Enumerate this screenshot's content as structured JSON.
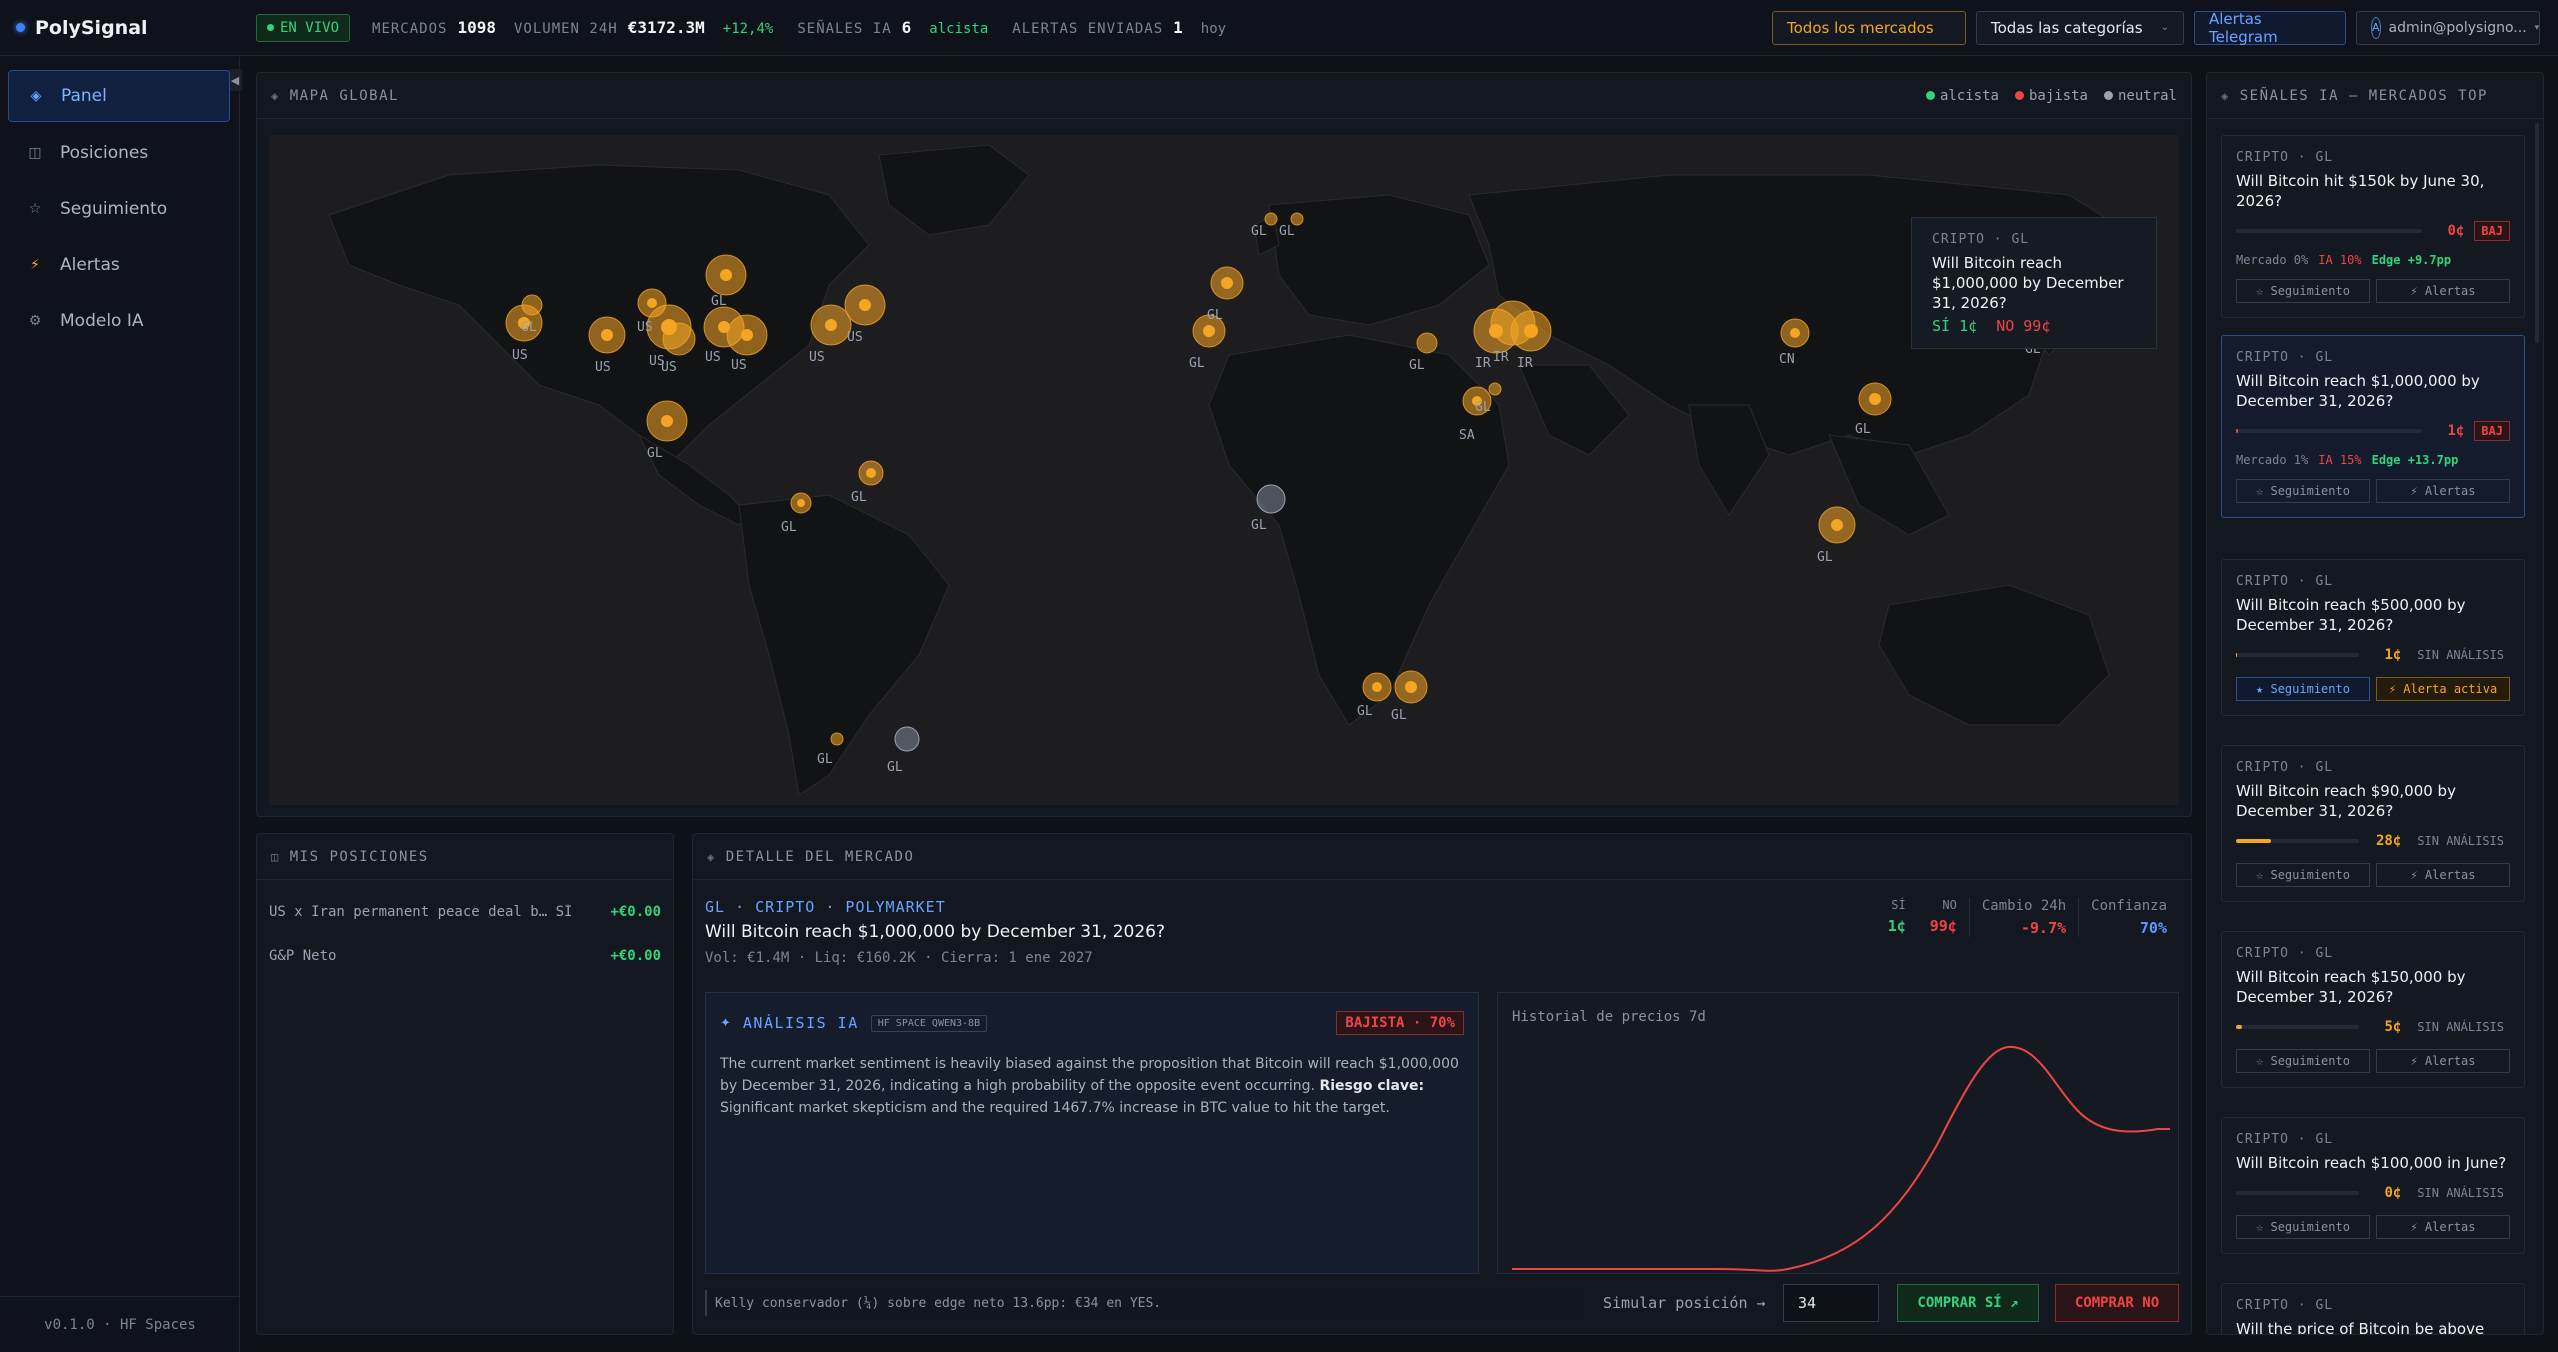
{
  "brand": "PolySignal",
  "live_label": "EN VIVO",
  "stats": {
    "markets_label": "MERCADOS",
    "markets_value": "1098",
    "volume_label": "VOLUMEN 24H",
    "volume_value": "€3172.3M",
    "volume_change": "+12,4%",
    "signals_label": "SEÑALES IA",
    "signals_value": "6",
    "signals_note": "alcista",
    "alerts_label": "ALERTAS ENVIADAS",
    "alerts_value": "1",
    "alerts_note": "hoy"
  },
  "filters": {
    "markets": "Todos los mercados",
    "categories": "Todas las categorías",
    "telegram": "Alertas Telegram",
    "user": "admin@polysigno...",
    "avatar": "A"
  },
  "sidebar": {
    "items": [
      {
        "label": "Panel",
        "icon": "diamond-icon"
      },
      {
        "label": "Posiciones",
        "icon": "grid-icon"
      },
      {
        "label": "Seguimiento",
        "icon": "star-icon"
      },
      {
        "label": "Alertas",
        "icon": "bolt-icon"
      },
      {
        "label": "Modelo IA",
        "icon": "gear-icon"
      }
    ],
    "version": "v0.1.0 · HF Spaces"
  },
  "map": {
    "title": "MAPA GLOBAL",
    "legend": [
      "alcista",
      "bajista",
      "neutral"
    ],
    "legend_colors": [
      "#34d27a",
      "#ef4444",
      "#9aa2b1"
    ],
    "tooltip": {
      "category": "CRIPTO · GL",
      "title": "Will Bitcoin reach $1,000,000 by December 31, 2026?",
      "yes": "SÍ 1¢",
      "no": "NO 99¢"
    }
  },
  "positions": {
    "title": "MIS POSICIONES",
    "rows": [
      {
        "label": "US x Iran permanent peace deal b… SÍ",
        "value": "+€0.00"
      },
      {
        "label": "G&P Neto",
        "value": "+€0.00"
      }
    ]
  },
  "detail": {
    "title": "DETALLE DEL MERCADO",
    "crumbs": "GL · CRIPTO · POLYMARKET",
    "market_title": "Will Bitcoin reach $1,000,000 by December 31, 2026?",
    "meta": "Vol: €1.4M · Liq: €160.2K · Cierra: 1 ene 2027",
    "yes_label": "SÍ",
    "yes_value": "1¢",
    "no_label": "NO",
    "no_value": "99¢",
    "change_label": "Cambio 24h",
    "change_value": "-9.7%",
    "confidence_label": "Confianza",
    "confidence_value": "70%",
    "ai_title": "ANÁLISIS IA",
    "ai_tag": "HF SPACE QWEN3-8B",
    "ai_badge": "BAJISTA · 70%",
    "ai_text": "The current market sentiment is heavily biased against the proposition that Bitcoin will reach $1,000,000 by December 31, 2026, indicating a high probability of the opposite event occurring.",
    "ai_risk_label": "Riesgo clave:",
    "ai_risk_text": "Significant market skepticism and the required 1467.7% increase in BTC value to hit the target.",
    "chart_title": "Historial de precios 7d",
    "kelly": "Kelly conservador (¼) sobre edge neto 13.6pp: €34 en YES.",
    "sim_label": "Simular posición →",
    "sim_value": "34",
    "buy_yes": "COMPRAR SÍ ↗",
    "buy_no": "COMPRAR NO"
  },
  "signals": {
    "title": "SEÑALES IA — MERCADOS TOP",
    "cards": [
      {
        "category": "CRIPTO · GL",
        "title": "Will Bitcoin hit $150k by June 30, 2026?",
        "price": "0¢",
        "price_color": "#ef4444",
        "bar": 0,
        "badge": "BAJ",
        "badge_type": "red",
        "meta_market": "Mercado 0%",
        "meta_ai": "IA 10%",
        "meta_edge": "Edge +9.7pp",
        "btn1": "☆ Seguimiento",
        "btn2": "⚡ Alertas",
        "btn1_type": "",
        "btn2_type": "",
        "selected": false
      },
      {
        "category": "CRIPTO · GL",
        "title": "Will Bitcoin reach $1,000,000 by December 31, 2026?",
        "price": "1¢",
        "price_color": "#ef4444",
        "bar": 0.01,
        "badge": "BAJ",
        "badge_type": "red",
        "meta_market": "Mercado 1%",
        "meta_ai": "IA 15%",
        "meta_edge": "Edge +13.7pp",
        "btn1": "☆ Seguimiento",
        "btn2": "⚡ Alertas",
        "btn1_type": "",
        "btn2_type": "",
        "selected": true
      },
      {
        "category": "CRIPTO · GL",
        "title": "Will Bitcoin reach $500,000 by December 31, 2026?",
        "price": "1¢",
        "price_color": "#f5a524",
        "bar": 0.01,
        "badge": "SIN ANÁLISIS",
        "badge_type": "muted",
        "btn1": "★ Seguimiento",
        "btn2": "⚡ Alerta activa",
        "btn1_type": "blue",
        "btn2_type": "orange",
        "selected": false
      },
      {
        "category": "CRIPTO · GL",
        "title": "Will Bitcoin reach $90,000 by December 31, 2026?",
        "price": "28¢",
        "price_color": "#f5a524",
        "bar": 0.28,
        "badge": "SIN ANÁLISIS",
        "badge_type": "muted",
        "btn1": "☆ Seguimiento",
        "btn2": "⚡ Alertas",
        "btn1_type": "",
        "btn2_type": "",
        "selected": false
      },
      {
        "category": "CRIPTO · GL",
        "title": "Will Bitcoin reach $150,000 by December 31, 2026?",
        "price": "5¢",
        "price_color": "#f5a524",
        "bar": 0.05,
        "badge": "SIN ANÁLISIS",
        "badge_type": "muted",
        "btn1": "☆ Seguimiento",
        "btn2": "⚡ Alertas",
        "btn1_type": "",
        "btn2_type": "",
        "selected": false
      },
      {
        "category": "CRIPTO · GL",
        "title": "Will Bitcoin reach $100,000 in June?",
        "price": "0¢",
        "price_color": "#f5a524",
        "bar": 0,
        "badge": "SIN ANÁLISIS",
        "badge_type": "muted",
        "btn1": "☆ Seguimiento",
        "btn2": "⚡ Alertas",
        "btn1_type": "",
        "btn2_type": "",
        "selected": false
      },
      {
        "category": "CRIPTO · GL",
        "title": "Will the price of Bitcoin be above",
        "price": "",
        "price_color": "#f5a524",
        "bar": 0,
        "badge": "",
        "badge_type": "muted",
        "btn1": "",
        "btn2": "",
        "btn1_type": "",
        "btn2_type": "",
        "selected": false
      }
    ]
  }
}
